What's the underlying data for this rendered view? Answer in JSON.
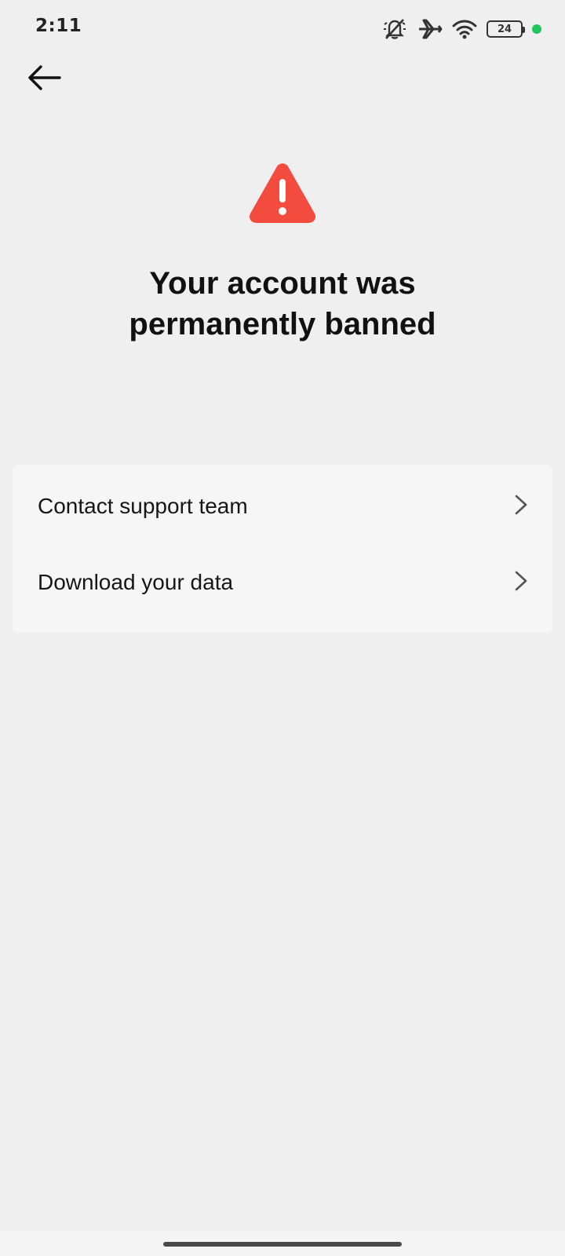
{
  "status_bar": {
    "time": "2:11",
    "battery_level": "24",
    "icons": [
      "bell-off-icon",
      "airplane-mode-icon",
      "wifi-icon",
      "battery-icon",
      "privacy-indicator-dot"
    ],
    "indicator_color": "#21c55d"
  },
  "header": {
    "back_icon": "arrow-left-icon"
  },
  "main": {
    "warning_icon": "warning-triangle-icon",
    "warning_color": "#f44b3f",
    "headline_line1": "Your account was",
    "headline_line2": "permanently banned"
  },
  "options": [
    {
      "label": "Contact support team",
      "icon": "chevron-right-icon"
    },
    {
      "label": "Download your data",
      "icon": "chevron-right-icon"
    }
  ]
}
